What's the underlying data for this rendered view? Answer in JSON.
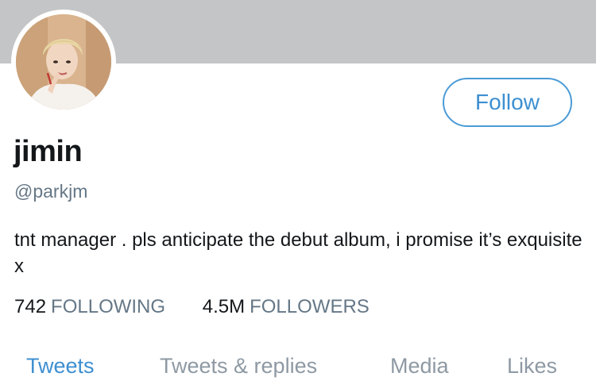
{
  "profile": {
    "name": "jimin",
    "handle": "@parkjm",
    "bio": "tnt manager . pls anticipate the debut album, i promise it’s exquisite x",
    "avatar_icon": "profile-photo"
  },
  "actions": {
    "follow_label": "Follow"
  },
  "stats": {
    "following_count": "742",
    "following_label": "FOLLOWING",
    "followers_count": "4.5M",
    "followers_label": "FOLLOWERS"
  },
  "tabs": [
    {
      "label": "Tweets",
      "active": true
    },
    {
      "label": "Tweets & replies",
      "active": false
    },
    {
      "label": "Media",
      "active": false
    },
    {
      "label": "Likes",
      "active": false
    }
  ],
  "colors": {
    "accent": "#3d8fd1",
    "banner": "#c4c5c7",
    "muted": "#657786",
    "text": "#14171a"
  }
}
